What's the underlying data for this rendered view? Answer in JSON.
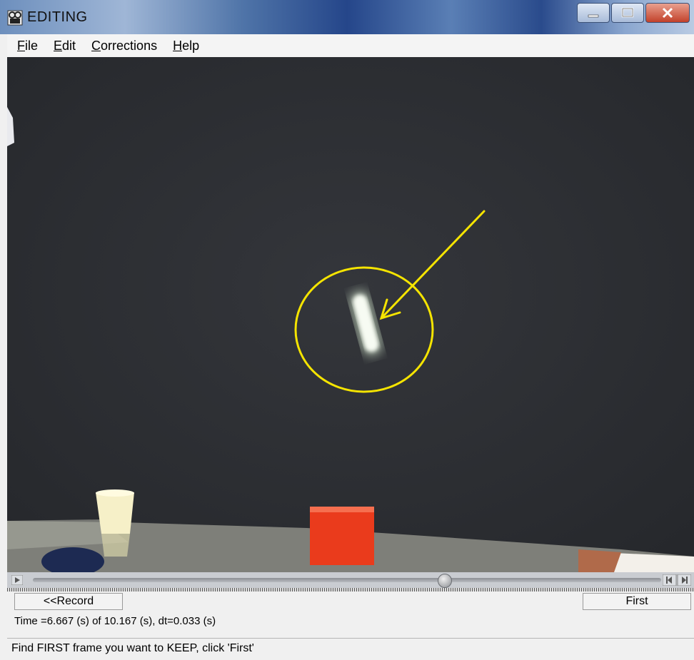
{
  "window": {
    "title": "EDITING",
    "icon": "film-camera-icon"
  },
  "menu": {
    "items": [
      {
        "label": "File",
        "accel": "F"
      },
      {
        "label": "Edit",
        "accel": "E"
      },
      {
        "label": "Corrections",
        "accel": "C"
      },
      {
        "label": "Help",
        "accel": "H"
      }
    ]
  },
  "video": {
    "annotation_color": "#f5e400",
    "background_color": "#2d2f34"
  },
  "playback": {
    "current_time_s": 6.667,
    "total_time_s": 10.167,
    "position_fraction": 0.656
  },
  "buttons": {
    "record_label": "<<Record",
    "first_label": "First"
  },
  "time_readout": "Time =6.667 (s) of 10.167 (s), dt=0.033 (s)",
  "status": {
    "message": "Find FIRST frame you want to KEEP, click 'First'"
  }
}
